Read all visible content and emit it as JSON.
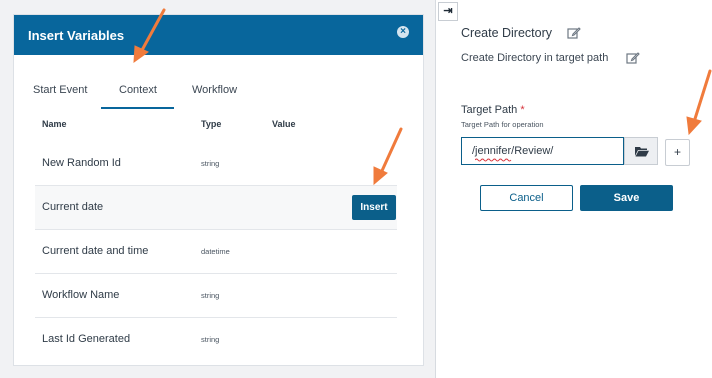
{
  "insert_panel": {
    "title": "Insert Variables",
    "close_glyph": "×",
    "tabs": [
      {
        "label": "Start Event"
      },
      {
        "label": "Context"
      },
      {
        "label": "Workflow"
      }
    ],
    "active_tab": "Context",
    "columns": {
      "name": "Name",
      "type": "Type",
      "value": "Value"
    },
    "rows": [
      {
        "name": "New Random Id",
        "type": "string"
      },
      {
        "name": "Current date",
        "type": ""
      },
      {
        "name": "Current date and time",
        "type": "datetime"
      },
      {
        "name": "Workflow Name",
        "type": "string"
      },
      {
        "name": "Last Id Generated",
        "type": "string"
      }
    ],
    "insert_label": "Insert"
  },
  "right_panel": {
    "collapse_glyph": "⇥",
    "title": "Create Directory",
    "subtitle": "Create Directory in target path",
    "field": {
      "label": "Target Path",
      "required_mark": "*",
      "help": "Target Path for operation",
      "value": "/jennifer/Review/"
    },
    "add_label": "+",
    "cancel_label": "Cancel",
    "save_label": "Save"
  },
  "icons": {
    "close": "close-circle-icon",
    "collapse": "collapse-right-icon",
    "edit": "edit-icon",
    "browse": "folder-open-icon",
    "annotation": "orange-arrow"
  },
  "colors": {
    "header": "#08669c",
    "primary": "#0b5f8a",
    "annotation_arrow": "#f07b3c",
    "required": "#d6323a"
  }
}
